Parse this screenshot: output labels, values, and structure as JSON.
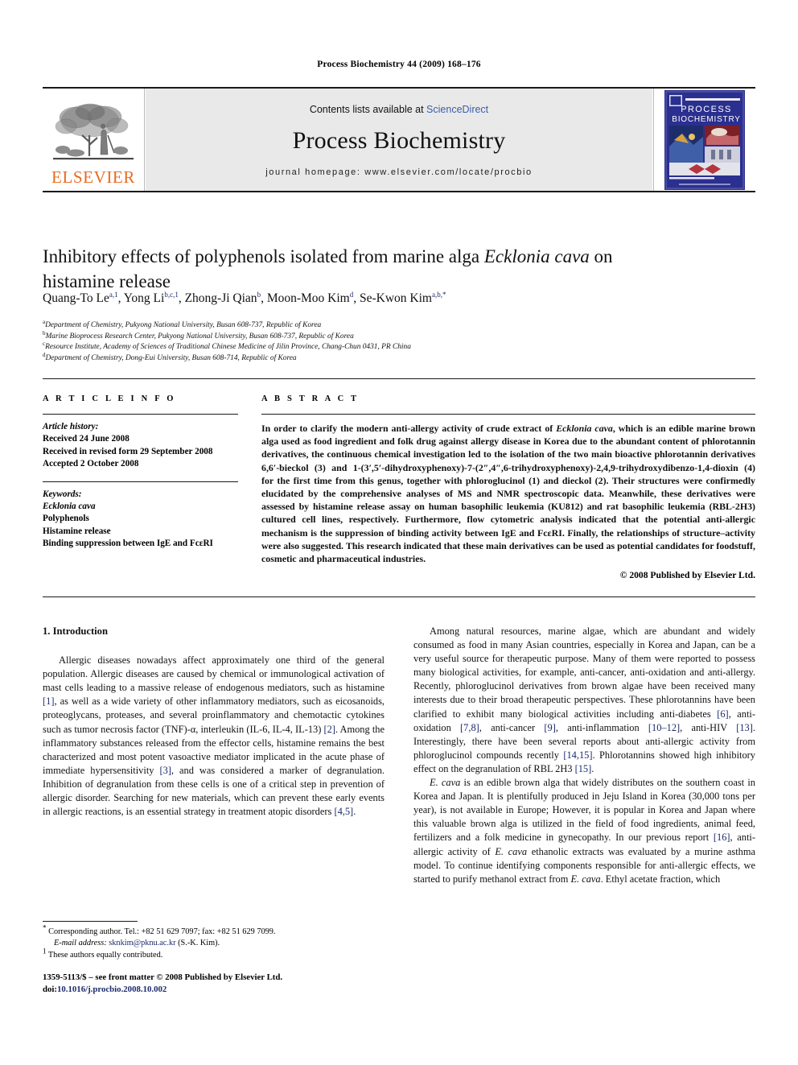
{
  "running_head": "Process Biochemistry 44 (2009) 168–176",
  "masthead": {
    "publisher_name": "ELSEVIER",
    "publisher_logo_icon": "elsevier-tree-icon",
    "contents_prefix": "Contents lists available at ",
    "contents_link": "ScienceDirect",
    "journal_name": "Process Biochemistry",
    "homepage": "journal homepage: www.elsevier.com/locate/procbio",
    "cover_title_line1": "PROCESS",
    "cover_title_line2": "BIOCHEMISTRY",
    "cover_color": "#2b2f8f",
    "link_color": "#3b5ea8",
    "brand_color": "#ea6a20"
  },
  "article": {
    "title_part1": "Inhibitory effects of polyphenols isolated from marine alga ",
    "title_italic": "Ecklonia cava",
    "title_part2": " on histamine release",
    "authors": [
      {
        "name": "Quang-To Le",
        "sup": "a,1",
        "sep": ", "
      },
      {
        "name": "Yong Li",
        "sup": "b,c,1",
        "sep": ", "
      },
      {
        "name": "Zhong-Ji Qian",
        "sup": "b",
        "sep": ", "
      },
      {
        "name": "Moon-Moo Kim",
        "sup": "d",
        "sep": ", "
      },
      {
        "name": "Se-Kwon Kim",
        "sup": "a,b,*",
        "sep": ""
      }
    ],
    "affiliations": [
      {
        "mark": "a",
        "text": "Department of Chemistry, Pukyong National University, Busan 608-737, Republic of Korea"
      },
      {
        "mark": "b",
        "text": "Marine Bioprocess Research Center, Pukyong National University, Busan 608-737, Republic of Korea"
      },
      {
        "mark": "c",
        "text": "Resource Institute, Academy of Sciences of Traditional Chinese Medicine of Jilin Province, Chang-Chun 0431, PR China"
      },
      {
        "mark": "d",
        "text": "Department of Chemistry, Dong-Eui University, Busan 608-714, Republic of Korea"
      }
    ]
  },
  "article_info": {
    "heading": "A R T I C L E   I N F O",
    "history_label": "Article history:",
    "history": [
      "Received 24 June 2008",
      "Received in revised form 29 September 2008",
      "Accepted 2 October 2008"
    ],
    "keywords_label": "Keywords:",
    "keywords": [
      "Ecklonia cava",
      "Polyphenols",
      "Histamine release",
      "Binding suppression between IgE and FcεRI"
    ],
    "keyword_italic_index": 0
  },
  "abstract": {
    "heading": "A B S T R A C T",
    "p1": "In order to clarify the modern anti-allergy activity of crude extract of ",
    "species": "Ecklonia cava",
    "p2": ", which is an edible marine brown alga used as food ingredient and folk drug against allergy disease in Korea due to the abundant content of phlorotannin derivatives, the continuous chemical investigation led to the isolation of the two main bioactive phlorotannin derivatives 6,6′-bieckol (3) and 1-(3′,5′-dihydroxyphenoxy)-7-(2″,4″,6-trihydroxyphenoxy)-2,4,9-trihydroxydibenzo-1,4-dioxin (4) for the first time from this genus, together with phloroglucinol (1) and dieckol (2). Their structures were confirmedly elucidated by the comprehensive analyses of MS and NMR spectroscopic data. Meanwhile, these derivatives were assessed by histamine release assay on human basophilic leukemia (KU812) and rat basophilic leukemia (RBL-2H3) cultured cell lines, respectively. Furthermore, flow cytometric analysis indicated that the potential anti-allergic mechanism is the suppression of binding activity between IgE and FcεRI. Finally, the relationships of structure–activity were also suggested. This research indicated that these main derivatives can be used as potential candidates for foodstuff, cosmetic and pharmaceutical industries.",
    "copyright": "© 2008 Published by Elsevier Ltd."
  },
  "body": {
    "section_heading": "1. Introduction",
    "left_paragraph_a": "Allergic diseases nowadays affect approximately one third of the general population. Allergic diseases are caused by chemical or immunological activation of mast cells leading to a massive release of endogenous mediators, such as histamine ",
    "left_ref_1": "[1]",
    "left_paragraph_b": ", as well as a wide variety of other inflammatory mediators, such as eicosanoids, proteoglycans, proteases, and several proinflammatory and chemotactic cytokines such as tumor necrosis factor (TNF)-α, interleukin (IL-6, IL-4, IL-13) ",
    "left_ref_2": "[2]",
    "left_paragraph_c": ". Among the inflammatory substances released from the effector cells, histamine remains the best characterized and most potent vasoactive mediator implicated in the acute phase of immediate hypersensitivity ",
    "left_ref_3": "[3]",
    "left_paragraph_d": ", and was considered a marker of degranulation. Inhibition of degranulation from these cells is one of a critical step in prevention of allergic disorder. Searching for new materials, which can prevent these early events in allergic reactions, is an essential strategy in treatment atopic disorders ",
    "left_ref_4": "[4,5]",
    "left_paragraph_e": ".",
    "right_p1_a": "Among natural resources, marine algae, which are abundant and widely consumed as food in many Asian countries, especially in Korea and Japan, can be a very useful source for therapeutic purpose. Many of them were reported to possess many biological activities, for example, anti-cancer, anti-oxidation and anti-allergy. Recently, phloroglucinol derivatives from brown algae have been received many interests due to their broad therapeutic perspectives. These phlorotannins have been clarified to exhibit many biological activities including anti-diabetes ",
    "right_ref_6": "[6]",
    "right_p1_b": ", anti-oxidation ",
    "right_ref_78": "[7,8]",
    "right_p1_c": ", anti-cancer ",
    "right_ref_9": "[9]",
    "right_p1_d": ", anti-inflammation ",
    "right_ref_1012": "[10–12]",
    "right_p1_e": ", anti-HIV ",
    "right_ref_13": "[13]",
    "right_p1_f": ". Interestingly, there have been several reports about anti-allergic activity from phloroglucinol compounds recently ",
    "right_ref_1415": "[14,15]",
    "right_p1_g": ". Phlorotannins showed high inhibitory effect on the degranulation of RBL 2H3 ",
    "right_ref_15": "[15]",
    "right_p1_h": ".",
    "right_p2_species1": "E. cava",
    "right_p2_a": " is an edible brown alga that widely distributes on the southern coast in Korea and Japan. It is plentifully produced in Jeju Island in Korea (30,000 tons per year), is not available in Europe; However, it is popular in Korea and Japan where this valuable brown alga is utilized in the field of food ingredients, animal feed, fertilizers and a folk medicine in gynecopathy. In our previous report ",
    "right_ref_16": "[16]",
    "right_p2_b": ", anti-allergic activity of ",
    "right_p2_species2": "E. cava",
    "right_p2_c": " ethanolic extracts was evaluated by a murine asthma model. To continue identifying components responsible for anti-allergic effects, we started to purify methanol extract from ",
    "right_p2_species3": "E. cava",
    "right_p2_d": ". Ethyl acetate fraction, which"
  },
  "footnotes": {
    "corresponding_mark": "*",
    "corresponding_text": "Corresponding author. Tel.: +82 51 629 7097; fax: +82 51 629 7099.",
    "email_label": "E-mail address:",
    "email": "sknkim@pknu.ac.kr",
    "email_owner": "(S.-K. Kim).",
    "equal_mark": "1",
    "equal_text": "These authors equally contributed."
  },
  "imprint": {
    "line1": "1359-5113/$ – see front matter © 2008 Published by Elsevier Ltd.",
    "doi_label": "doi:",
    "doi": "10.1016/j.procbio.2008.10.002"
  }
}
